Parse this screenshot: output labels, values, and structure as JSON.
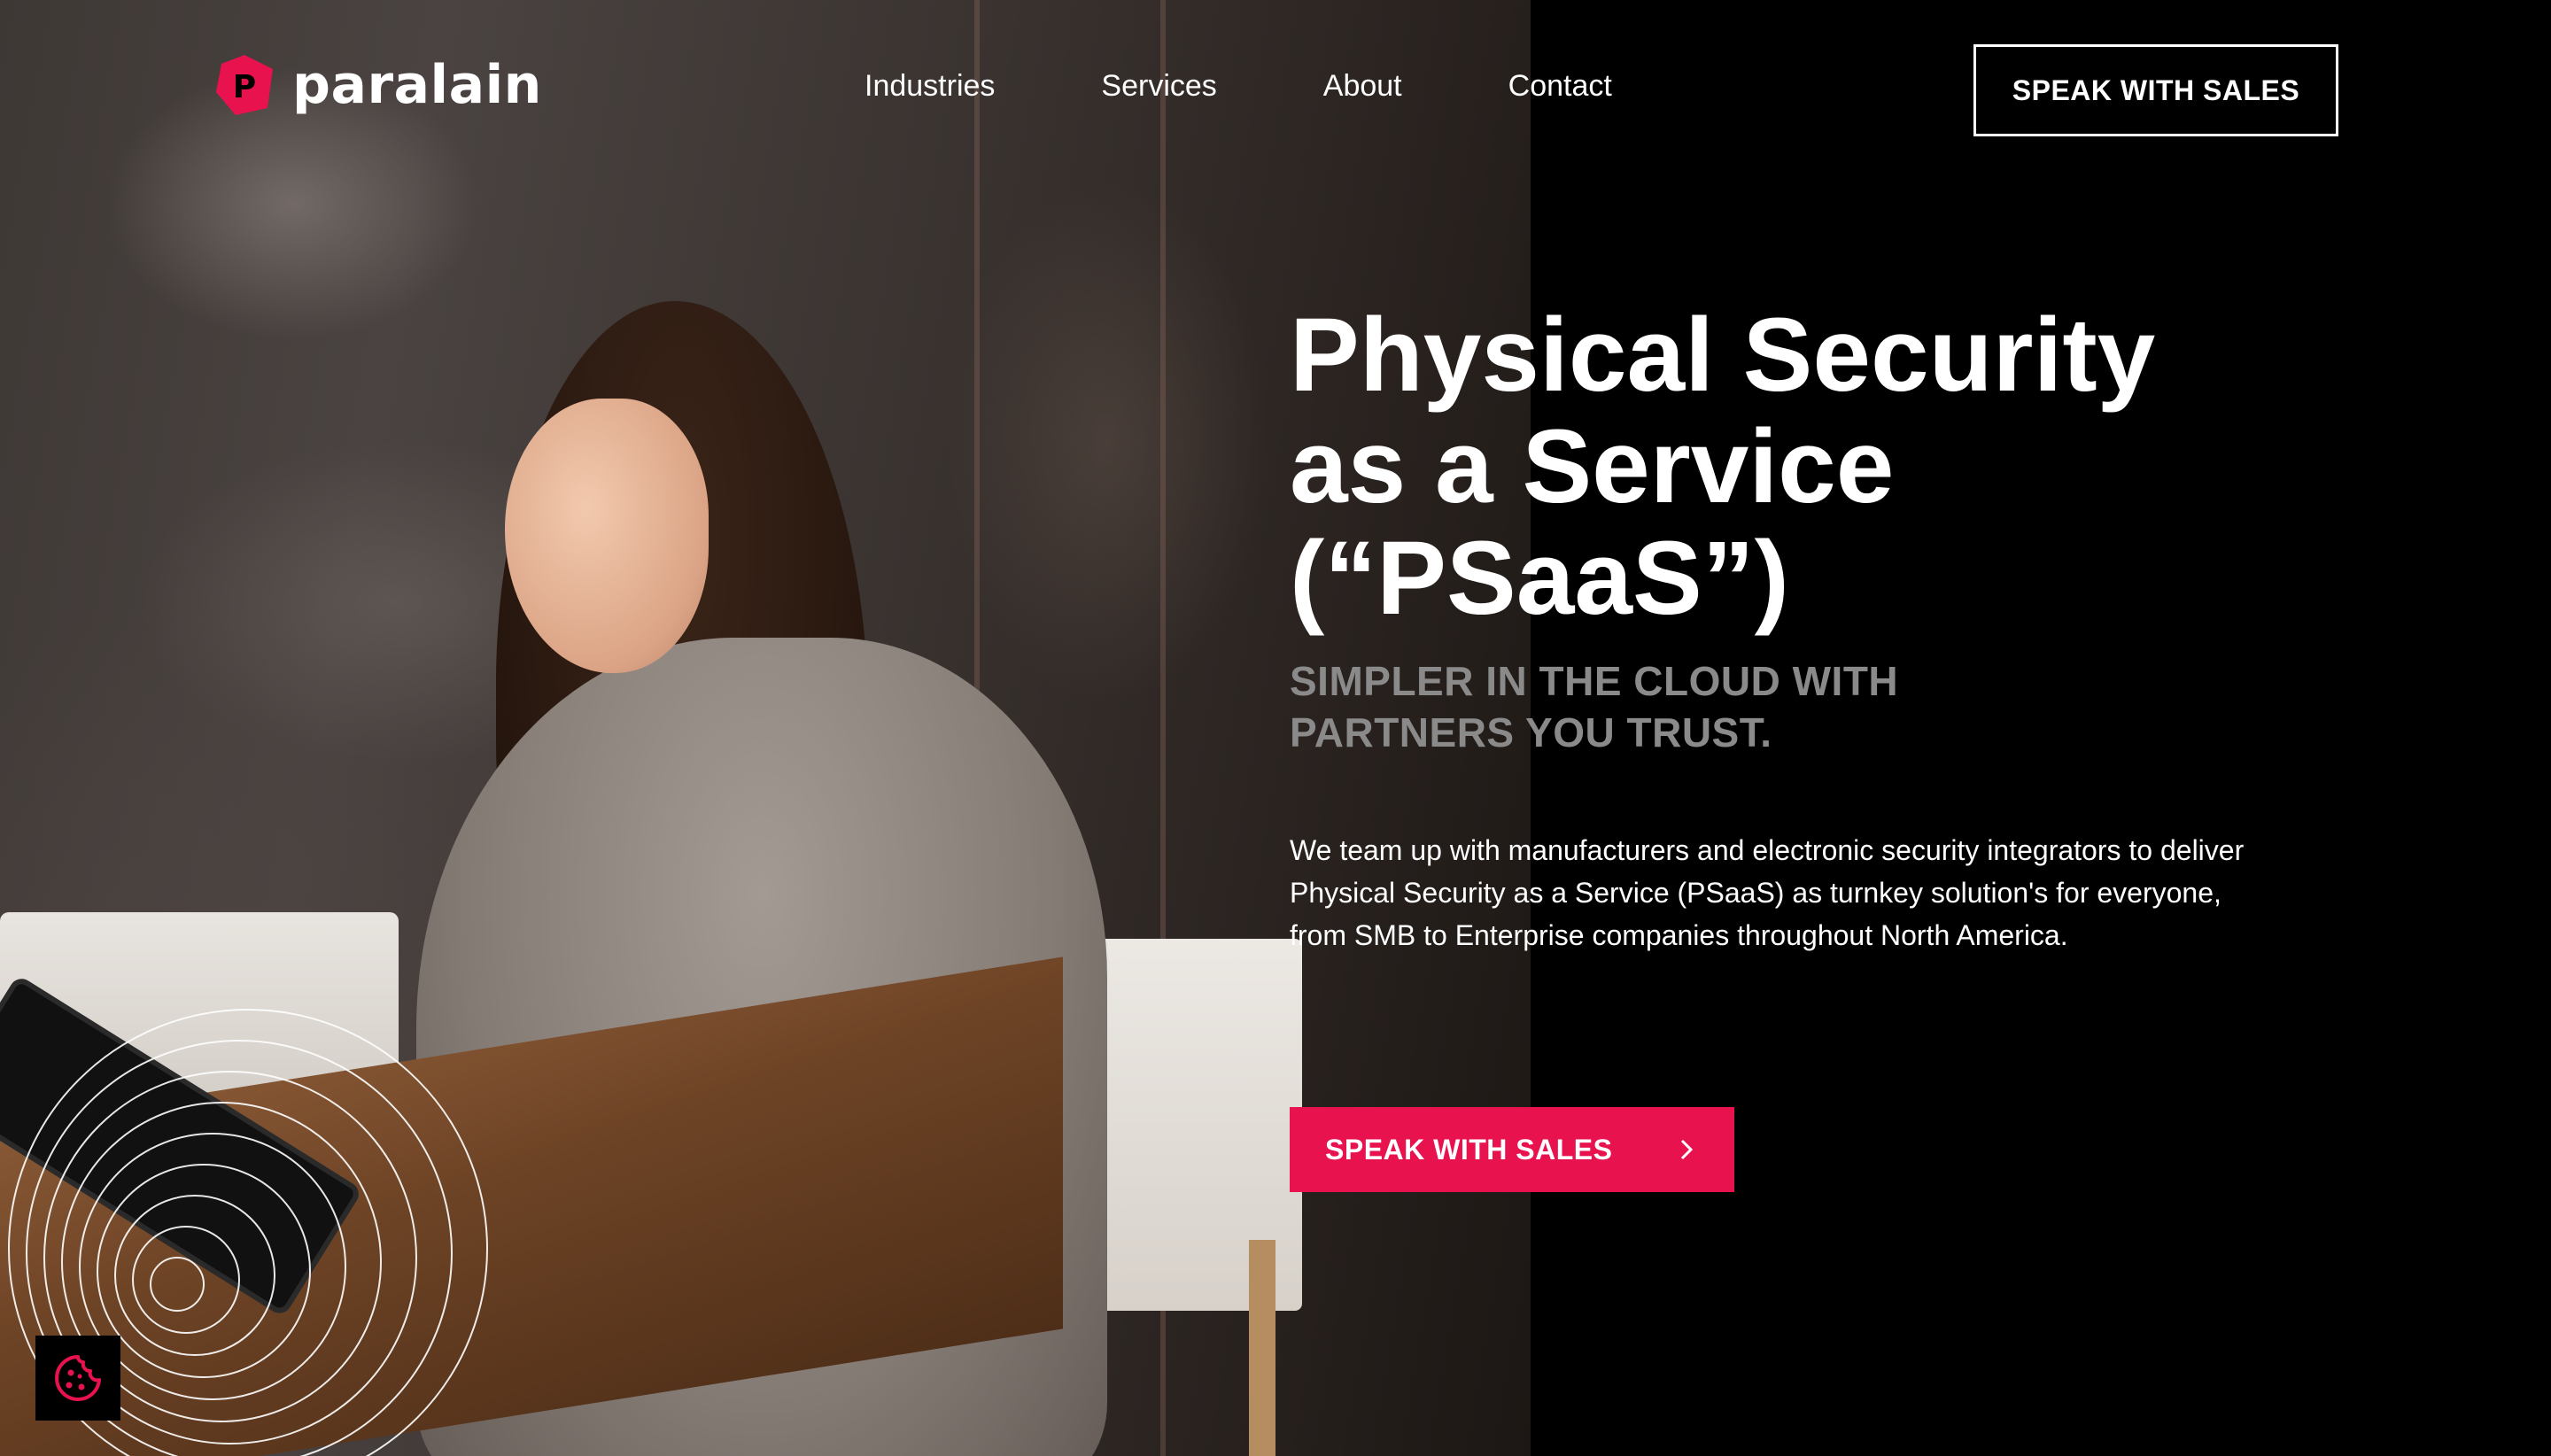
{
  "brand": {
    "name": "paralain",
    "logo_letter": "P",
    "accent_color": "#e8124f"
  },
  "nav": {
    "items": [
      {
        "label": "Industries"
      },
      {
        "label": "Services"
      },
      {
        "label": "About"
      },
      {
        "label": "Contact"
      }
    ]
  },
  "header": {
    "cta_label": "SPEAK WITH SALES"
  },
  "hero": {
    "title_lines": [
      "Physical Security",
      "as a Service",
      "(“PSaaS”)"
    ],
    "subtitle_lines": [
      "SIMPLER IN THE CLOUD WITH",
      "PARTNERS YOU TRUST."
    ],
    "description": "We team up with manufacturers and electronic security integrators to deliver Physical Security as a Service (PSaaS) as turnkey solution's for everyone, from SMB to Enterprise companies throughout North America.",
    "cta_label": "SPEAK WITH SALES",
    "cta_icon": "chevron-right-icon"
  },
  "cookie": {
    "icon": "cookie-icon"
  }
}
